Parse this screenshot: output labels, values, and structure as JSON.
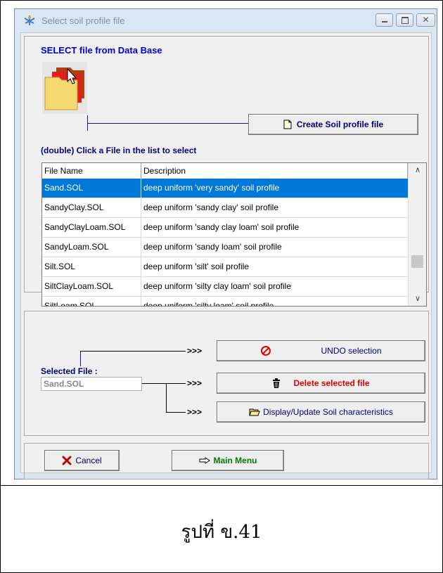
{
  "window": {
    "title": "Select soil profile file"
  },
  "top_panel": {
    "heading": "SELECT file from Data Base",
    "create_button": "Create Soil profile file",
    "hint": "(double) Click a File in the list to select"
  },
  "file_table": {
    "columns": [
      "File Name",
      "Description"
    ],
    "rows": [
      {
        "name": "Sand.SOL",
        "description": "deep uniform 'very sandy' soil profile",
        "selected": true
      },
      {
        "name": "SandyClay.SOL",
        "description": "deep uniform 'sandy clay' soil profile"
      },
      {
        "name": "SandyClayLoam.SOL",
        "description": "deep uniform 'sandy clay loam' soil profile"
      },
      {
        "name": "SandyLoam.SOL",
        "description": "deep uniform 'sandy loam' soil profile"
      },
      {
        "name": "Silt.SOL",
        "description": "deep uniform 'silt' soil profile"
      },
      {
        "name": "SiltClayLoam.SOL",
        "description": "deep uniform 'silty clay loam' soil profile"
      },
      {
        "name": "SiltLoam.SOL",
        "description": "deep uniform 'silty loam' soil profile"
      }
    ]
  },
  "selection_panel": {
    "label": "Selected File :",
    "value": "Sand.SOL",
    "arrow": ">>>",
    "undo_button": "UNDO selection",
    "delete_button": "Delete selected file",
    "display_button": "Display/Update Soil characteristics"
  },
  "bottom_panel": {
    "cancel_button": "Cancel",
    "main_menu_button": "Main Menu"
  },
  "caption": "รูปที่ ข.41",
  "colors": {
    "selection": "#0078d7",
    "heading": "#0000c8",
    "delete": "#e00000",
    "main_menu": "#007a00"
  },
  "icons": [
    "app-icon",
    "folder-icon",
    "new-file-icon",
    "no-entry-icon",
    "trash-icon",
    "open-folder-icon",
    "red-x-icon",
    "pointing-hand-icon"
  ]
}
